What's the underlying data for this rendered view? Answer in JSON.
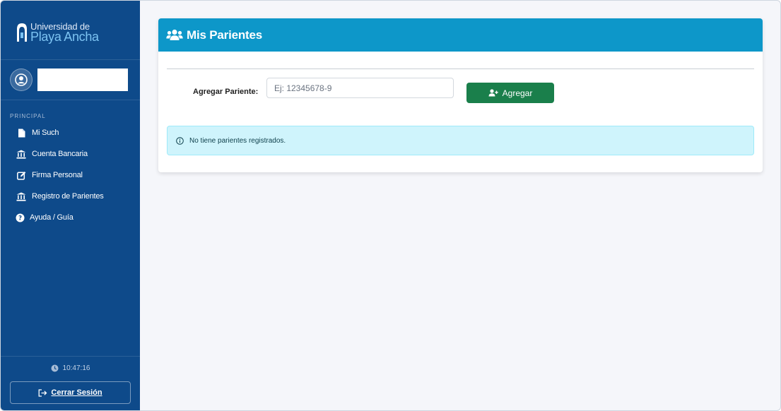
{
  "sidebar": {
    "logo": {
      "line1": "Universidad de",
      "line2": "Playa Ancha"
    },
    "section_label": "PRINCIPAL",
    "items": [
      {
        "label": "Mi Such",
        "icon": "file-icon"
      },
      {
        "label": "Cuenta Bancaria",
        "icon": "bank-icon"
      },
      {
        "label": "Firma Personal",
        "icon": "edit-icon"
      },
      {
        "label": "Registro de Parientes",
        "icon": "bank-icon"
      },
      {
        "label": "Ayuda / Guía",
        "icon": "question-circle-icon"
      }
    ],
    "clock": "10:47:16",
    "logout_label": "Cerrar Sesión"
  },
  "card": {
    "title": "Mis Parientes",
    "form_label": "Agregar Pariente:",
    "input_placeholder": "Ej: 12345678-9",
    "input_value": "",
    "add_button_label": "Agregar",
    "alert_text": "No tiene parientes registrados."
  },
  "colors": {
    "sidebar_bg": "#0e4a8a",
    "header_bg": "#0d97c9",
    "add_button_bg": "#1a7f4b",
    "alert_bg": "#cff4fc",
    "page_bg": "#f5f6fa"
  }
}
